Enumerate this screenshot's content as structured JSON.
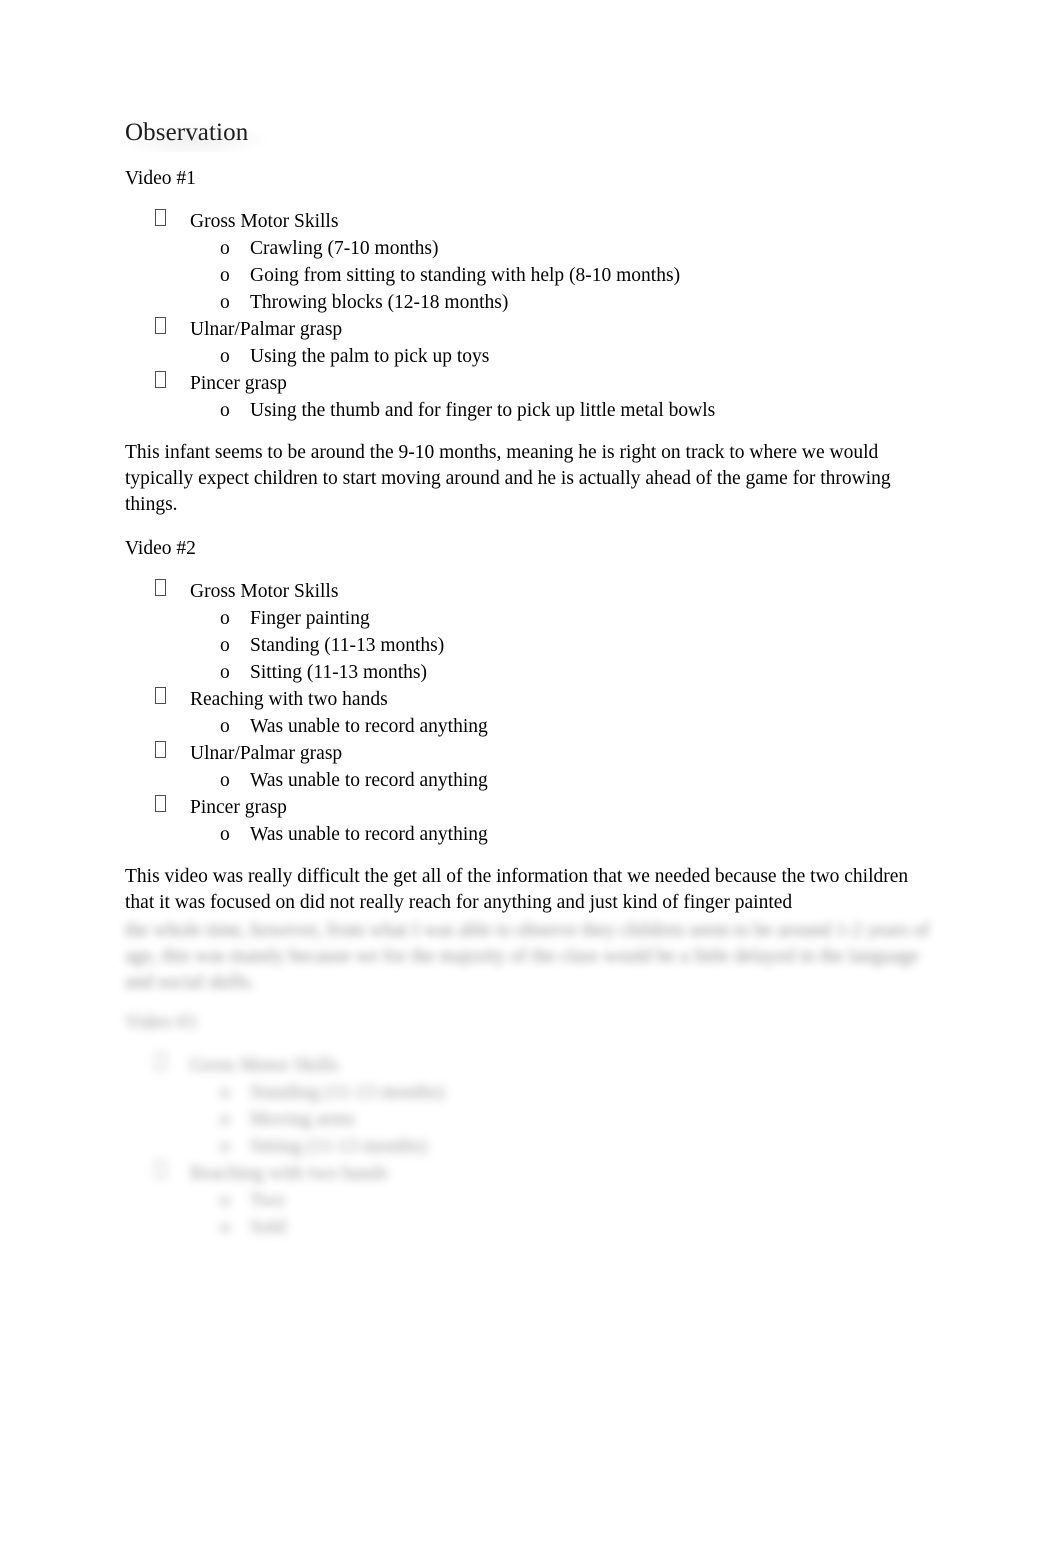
{
  "document": {
    "title": "Observation",
    "sections": [
      {
        "heading": "Video #1",
        "bullets": [
          {
            "text": "Gross Motor Skills",
            "sub": [
              "Crawling (7-10 months)",
              "Going from sitting to standing with help (8-10 months)",
              "Throwing blocks (12-18 months)"
            ]
          },
          {
            "text": "Ulnar/Palmar grasp",
            "sub": [
              "Using the palm to pick up toys"
            ]
          },
          {
            "text": "Pincer grasp",
            "sub": [
              "Using the thumb and for finger to pick up little metal bowls"
            ]
          }
        ],
        "paragraph": "This infant seems to be around the 9-10 months, meaning he is right on track to where we would typically expect children to start moving around and he is actually ahead of the game for throwing things."
      },
      {
        "heading": "Video #2",
        "bullets": [
          {
            "text": "Gross Motor Skills",
            "sub": [
              "Finger painting",
              "Standing (11-13 months)",
              "Sitting (11-13 months)"
            ]
          },
          {
            "text": "Reaching with two hands",
            "sub": [
              "Was unable to record anything"
            ]
          },
          {
            "text": "Ulnar/Palmar grasp",
            "sub": [
              "Was unable to record anything"
            ]
          },
          {
            "text": "Pincer grasp",
            "sub": [
              "Was unable to record anything"
            ]
          }
        ],
        "paragraph_visible": "This video was really difficult the get all of the information that we needed because the two children that it was focused on did not really reach for anything and just kind of finger painted",
        "paragraph_blurred_lines": [
          "the whole time, however, from what I was able to observe they children seem to be around 1-2 years of age, this was mainly because we for the majority of the class would be a little delayed in the language and social skills.",
          "",
          ""
        ]
      },
      {
        "heading": "Video #3",
        "blurred": true,
        "bullets": [
          {
            "text": "Gross Motor Skills",
            "sub": [
              "Standing (11-13 months)",
              "Moving arms",
              "Sitting (11-13 months)"
            ]
          },
          {
            "text": "Reaching with two hands",
            "sub": [
              "Two",
              "Sold"
            ]
          }
        ]
      }
    ],
    "bullet_marker_level1": "missing-glyph-box",
    "bullet_marker_level2": "o"
  }
}
